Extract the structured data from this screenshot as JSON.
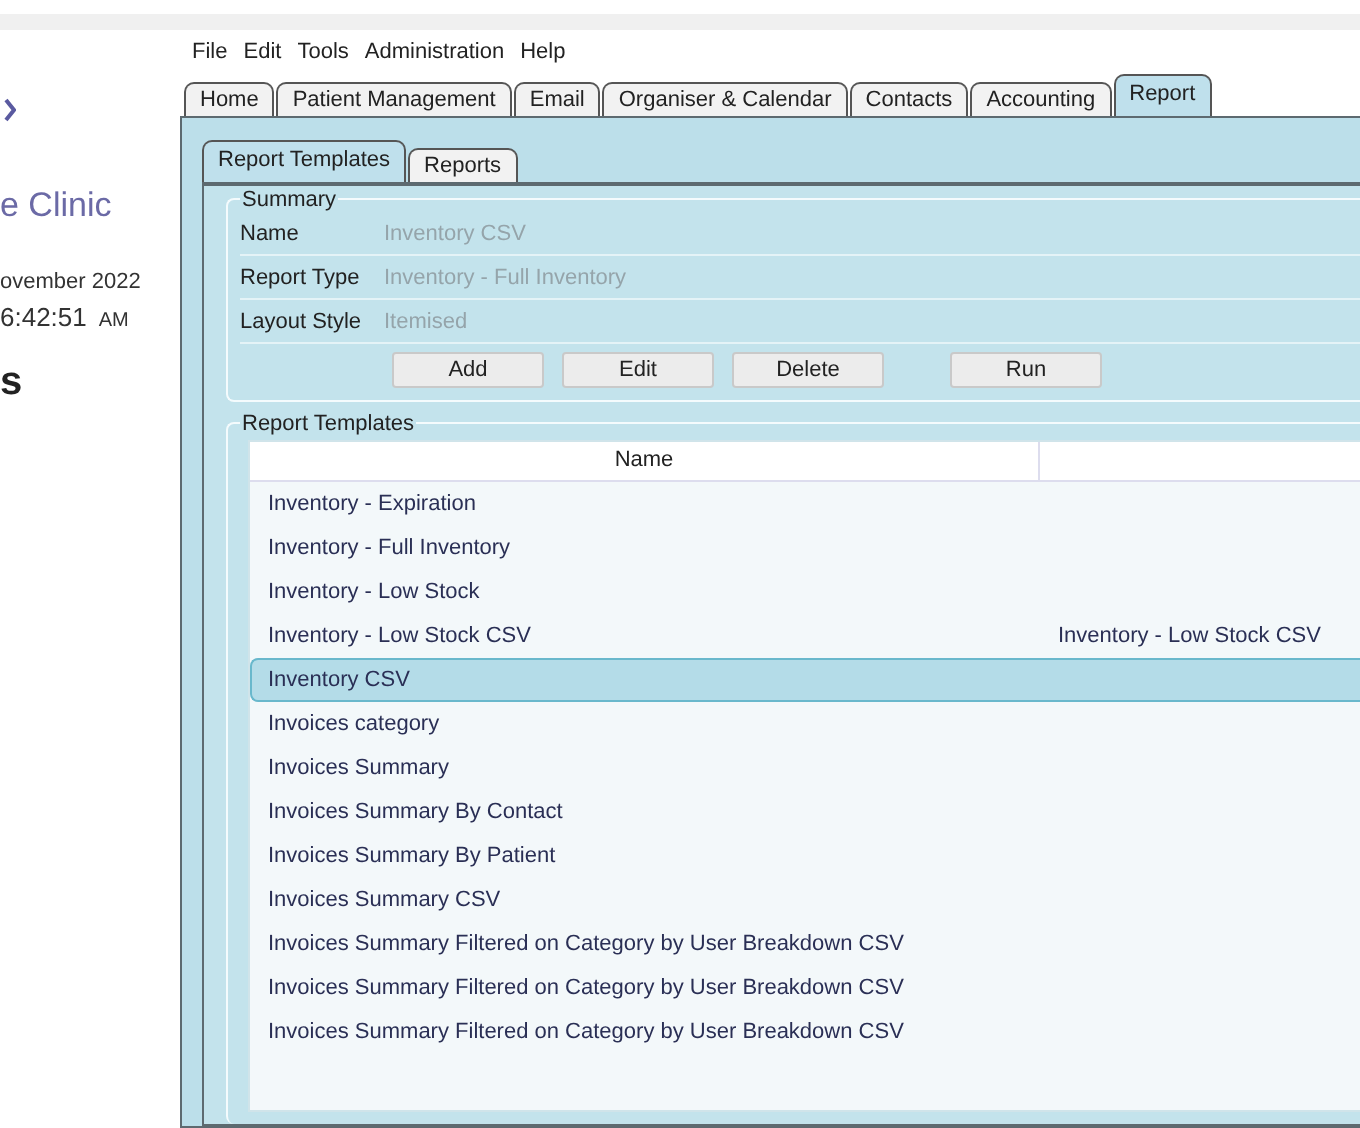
{
  "sidebar": {
    "clinic_name": "e Clinic",
    "date": "ovember 2022",
    "time": "6:42:51",
    "meridiem": "AM",
    "heading": "s"
  },
  "menu": [
    "File",
    "Edit",
    "Tools",
    "Administration",
    "Help"
  ],
  "tabs": [
    {
      "label": "Home",
      "selected": false
    },
    {
      "label": "Patient Management",
      "selected": false
    },
    {
      "label": "Email",
      "selected": false
    },
    {
      "label": "Organiser & Calendar",
      "selected": false
    },
    {
      "label": "Contacts",
      "selected": false
    },
    {
      "label": "Accounting",
      "selected": false
    },
    {
      "label": "Report",
      "selected": true
    }
  ],
  "inner_tabs": [
    {
      "label": "Report Templates",
      "selected": true
    },
    {
      "label": "Reports",
      "selected": false
    }
  ],
  "summary": {
    "title": "Summary",
    "fields": [
      {
        "label": "Name",
        "value": "Inventory CSV"
      },
      {
        "label": "Report Type",
        "value": "Inventory - Full Inventory"
      },
      {
        "label": "Layout Style",
        "value": "Itemised"
      }
    ],
    "buttons": [
      "Add",
      "Edit",
      "Delete",
      "Run"
    ]
  },
  "templates": {
    "title": "Report Templates",
    "columns": [
      "Name"
    ],
    "rows": [
      {
        "cells": [
          "Inventory - Expiration"
        ],
        "selected": false
      },
      {
        "cells": [
          "Inventory - Full Inventory"
        ],
        "selected": false
      },
      {
        "cells": [
          "Inventory - Low Stock"
        ],
        "selected": false
      },
      {
        "cells": [
          "Inventory - Low Stock CSV",
          "Inventory - Low Stock CSV"
        ],
        "selected": false
      },
      {
        "cells": [
          "Inventory CSV"
        ],
        "selected": true
      },
      {
        "cells": [
          "Invoices category"
        ],
        "selected": false
      },
      {
        "cells": [
          "Invoices Summary"
        ],
        "selected": false
      },
      {
        "cells": [
          "Invoices Summary By Contact"
        ],
        "selected": false
      },
      {
        "cells": [
          "Invoices Summary By Patient"
        ],
        "selected": false
      },
      {
        "cells": [
          "Invoices Summary CSV"
        ],
        "selected": false
      },
      {
        "cells": [
          "Invoices Summary Filtered on Category by User Breakdown CSV"
        ],
        "selected": false
      },
      {
        "cells": [
          "Invoices Summary Filtered on Category by User Breakdown CSV"
        ],
        "selected": false
      },
      {
        "cells": [
          "Invoices Summary Filtered on Category by User Breakdown CSV"
        ],
        "selected": false
      }
    ]
  }
}
